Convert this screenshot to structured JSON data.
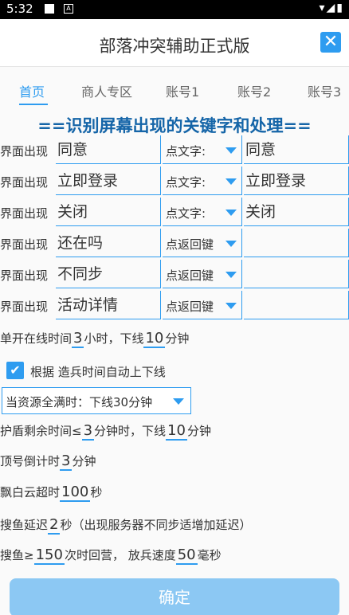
{
  "status": {
    "time": "5:32",
    "icon_a": "A"
  },
  "title": "部落冲突辅助正式版",
  "tabs": [
    "首页",
    "商人专区",
    "账号1",
    "账号2",
    "账号3"
  ],
  "section_title": "==识别屏幕出现的关键字和处理==",
  "rule_label": "界面出现",
  "rules": [
    {
      "keyword": "同意",
      "action": "点文字:",
      "value": "同意"
    },
    {
      "keyword": "立即登录",
      "action": "点文字:",
      "value": "立即登录"
    },
    {
      "keyword": "关闭",
      "action": "点文字:",
      "value": "关闭"
    },
    {
      "keyword": "还在吗",
      "action": "点返回键",
      "value": ""
    },
    {
      "keyword": "不同步",
      "action": "点返回键",
      "value": ""
    },
    {
      "keyword": "活动详情",
      "action": "点返回键",
      "value": ""
    }
  ],
  "online": {
    "prefix": "单开在线时间",
    "hours": "3",
    "mid": "小时，下线",
    "minutes": "10",
    "suffix": "分钟"
  },
  "auto_checkbox": {
    "label": "根据 造兵时间自动上下线"
  },
  "resource_full": {
    "selected": "当资源全满时：下线30分钟"
  },
  "shield": {
    "prefix": "护盾剩余时间≤",
    "value": "3",
    "mid": "分钟时，下线",
    "minutes": "10",
    "suffix": "分钟"
  },
  "countdown": {
    "prefix": "顶号倒计时",
    "value": "3",
    "suffix": "分钟"
  },
  "cloud": {
    "prefix": "飘白云超时",
    "value": "100",
    "suffix": "秒"
  },
  "search_delay": {
    "prefix": "搜鱼延迟",
    "value": "2",
    "suffix": "秒（出现服务器不同步适增加延迟）"
  },
  "search_return": {
    "prefix": "搜鱼≥",
    "value": "150",
    "mid": "次时回营，  放兵速度",
    "speed": "50",
    "suffix": "毫秒"
  },
  "confirm_label": "确定"
}
